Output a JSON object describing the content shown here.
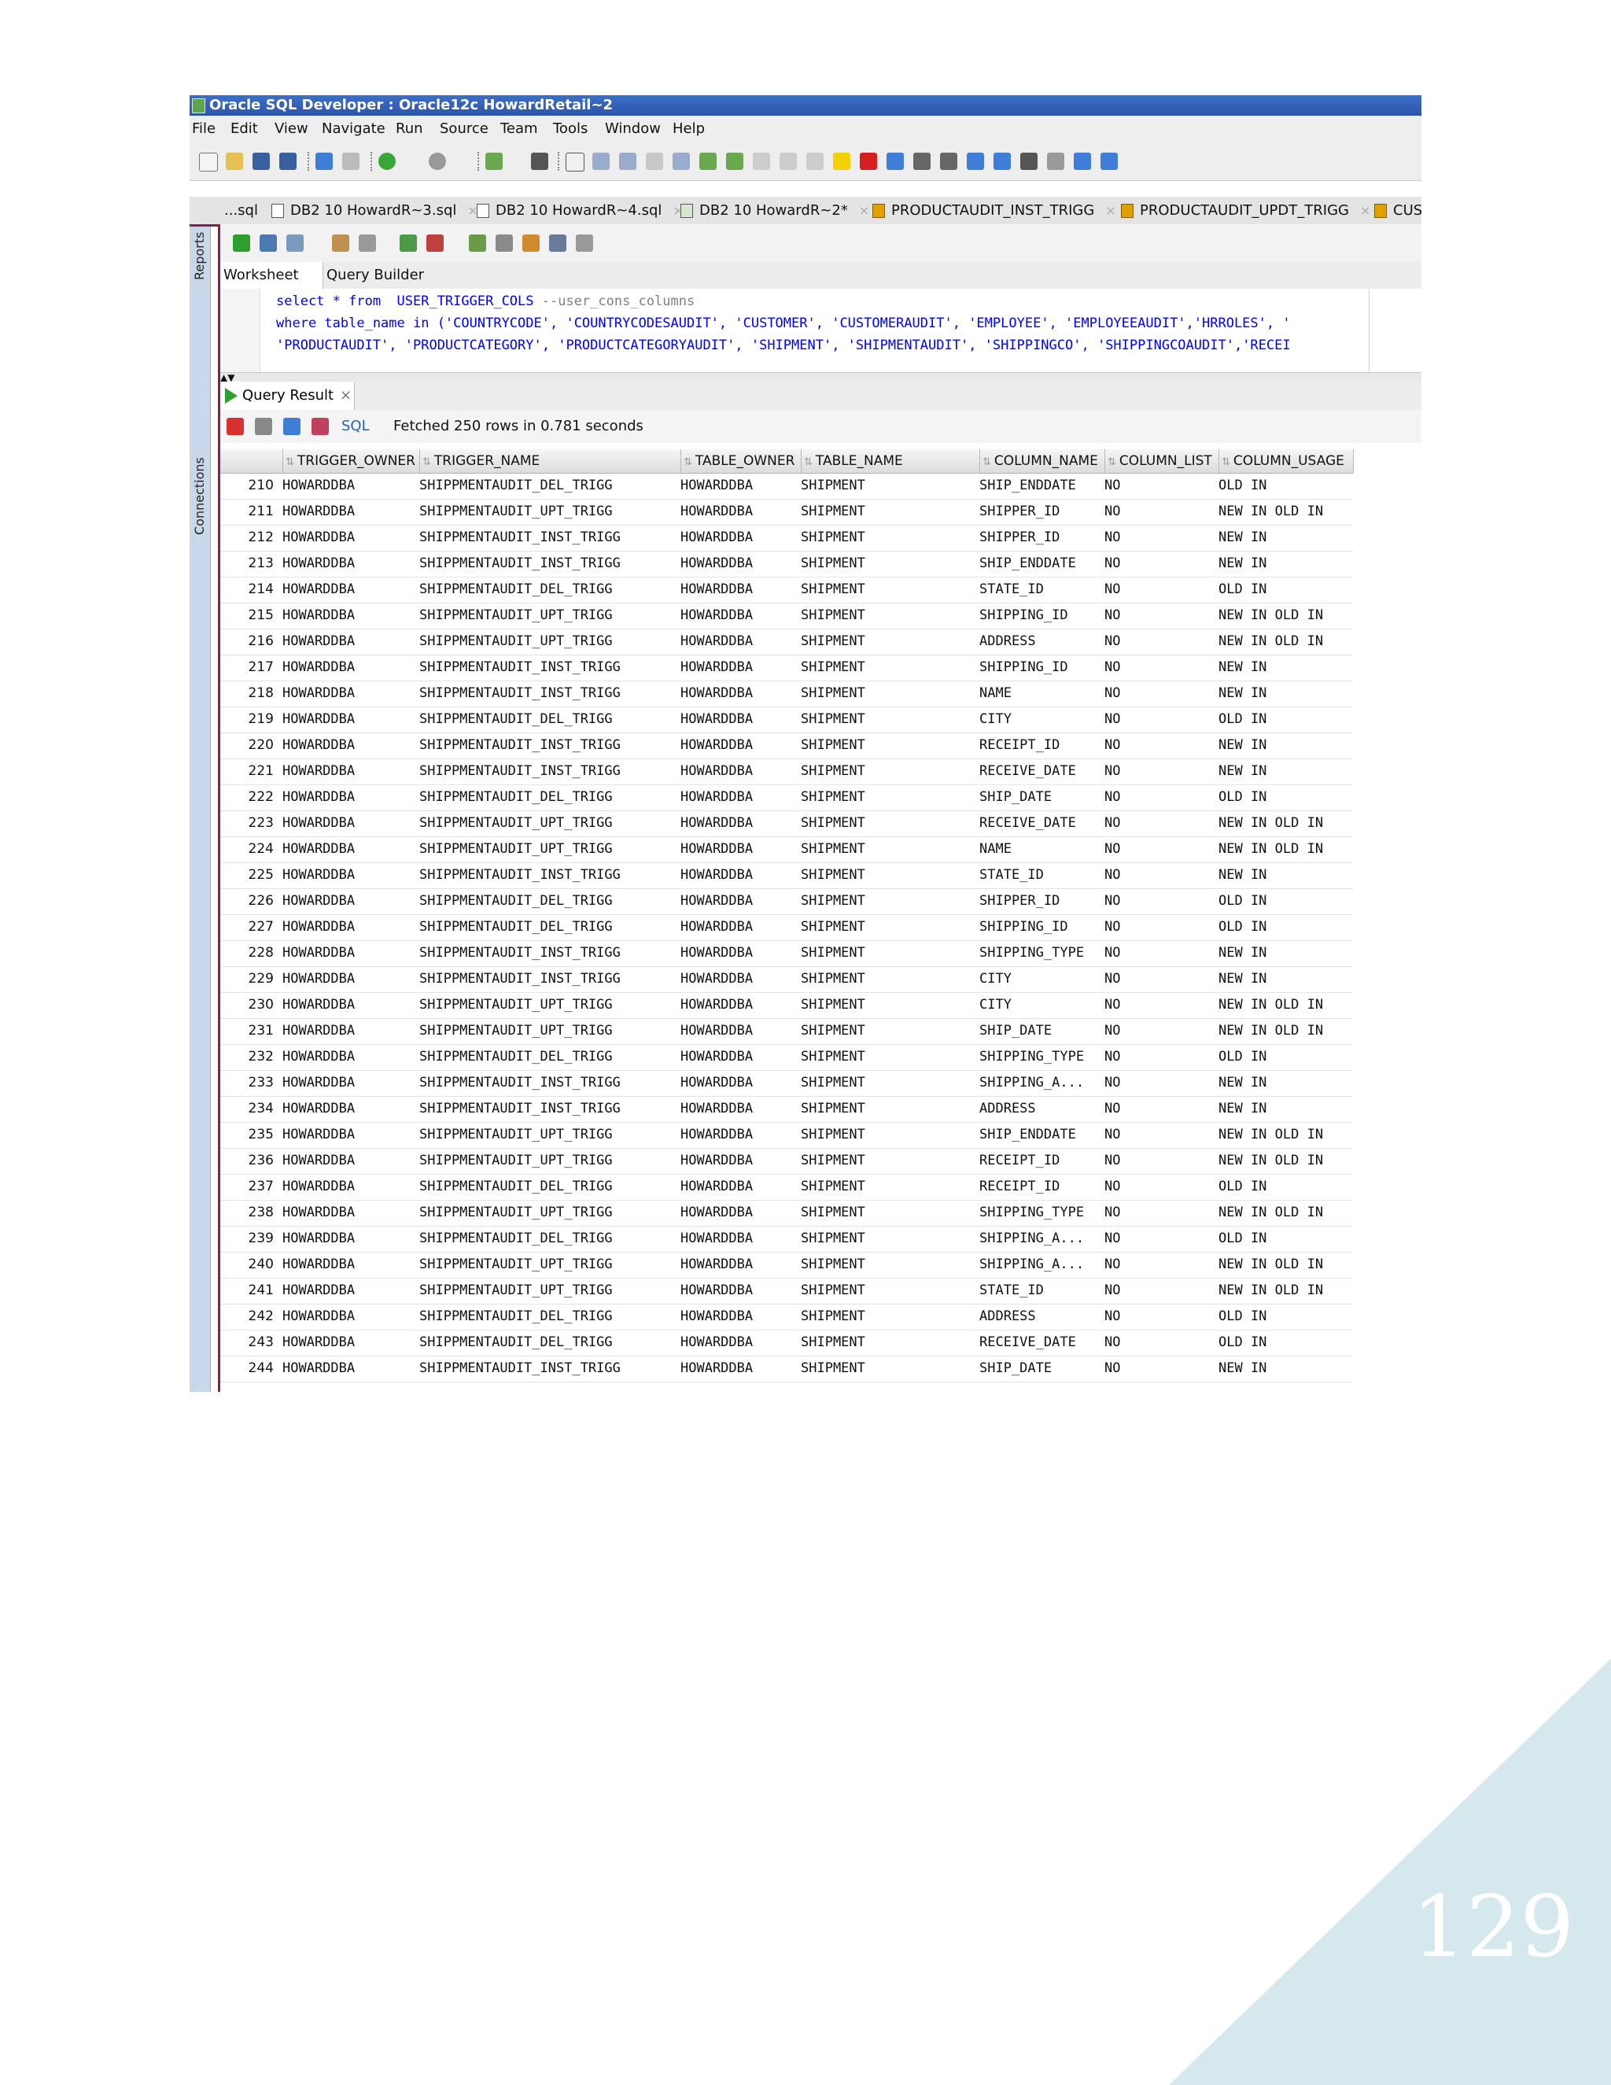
{
  "window": {
    "title": "Oracle SQL Developer : Oracle12c HowardRetail~2",
    "menu": [
      "File",
      "Edit",
      "View",
      "Navigate",
      "Run",
      "Source",
      "Team",
      "Tools",
      "Window",
      "Help"
    ]
  },
  "editor_tabs": [
    {
      "label": "...sql",
      "icon": "sql-file-icon"
    },
    {
      "label": "DB2 10 HowardR~3.sql",
      "icon": "sql-file-icon"
    },
    {
      "label": "DB2 10 HowardR~4.sql",
      "icon": "sql-file-icon"
    },
    {
      "label": "DB2 10 HowardR~2*",
      "icon": "connection-icon"
    },
    {
      "label": "PRODUCTAUDIT_INST_TRIGG",
      "icon": "trigger-icon"
    },
    {
      "label": "PRODUCTAUDIT_UPDT_TRIGG",
      "icon": "trigger-icon"
    },
    {
      "label": "CUS",
      "icon": "trigger-icon"
    }
  ],
  "side_panels": {
    "reports": "Reports",
    "connections": "Connections"
  },
  "worksheet_tabs": {
    "worksheet": "Worksheet",
    "query_builder": "Query Builder"
  },
  "sql": {
    "line1": "select * from  USER_TRIGGER_COLS --user_cons_columns",
    "line2": "where table_name in ('COUNTRYCODE', 'COUNTRYCODESAUDIT', 'CUSTOMER', 'CUSTOMERAUDIT', 'EMPLOYEE', 'EMPLOYEEAUDIT','HRROLES', '",
    "line3": "'PRODUCTAUDIT', 'PRODUCTCATEGORY', 'PRODUCTCATEGORYAUDIT', 'SHIPMENT', 'SHIPMENTAUDIT', 'SHIPPINGCO', 'SHIPPINGCOAUDIT','RECEI"
  },
  "query_result": {
    "tab_label": "Query Result",
    "sql_link": "SQL",
    "status": "Fetched 250 rows in 0.781 seconds",
    "columns": [
      "TRIGGER_OWNER",
      "TRIGGER_NAME",
      "TABLE_OWNER",
      "TABLE_NAME",
      "COLUMN_NAME",
      "COLUMN_LIST",
      "COLUMN_USAGE"
    ],
    "rows": [
      [
        "210",
        "HOWARDDBA",
        "SHIPPMENTAUDIT_DEL_TRIGG",
        "HOWARDDBA",
        "SHIPMENT",
        "SHIP_ENDDATE",
        "NO",
        "OLD IN"
      ],
      [
        "211",
        "HOWARDDBA",
        "SHIPPMENTAUDIT_UPT_TRIGG",
        "HOWARDDBA",
        "SHIPMENT",
        "SHIPPER_ID",
        "NO",
        "NEW IN OLD IN"
      ],
      [
        "212",
        "HOWARDDBA",
        "SHIPPMENTAUDIT_INST_TRIGG",
        "HOWARDDBA",
        "SHIPMENT",
        "SHIPPER_ID",
        "NO",
        "NEW IN"
      ],
      [
        "213",
        "HOWARDDBA",
        "SHIPPMENTAUDIT_INST_TRIGG",
        "HOWARDDBA",
        "SHIPMENT",
        "SHIP_ENDDATE",
        "NO",
        "NEW IN"
      ],
      [
        "214",
        "HOWARDDBA",
        "SHIPPMENTAUDIT_DEL_TRIGG",
        "HOWARDDBA",
        "SHIPMENT",
        "STATE_ID",
        "NO",
        "OLD IN"
      ],
      [
        "215",
        "HOWARDDBA",
        "SHIPPMENTAUDIT_UPT_TRIGG",
        "HOWARDDBA",
        "SHIPMENT",
        "SHIPPING_ID",
        "NO",
        "NEW IN OLD IN"
      ],
      [
        "216",
        "HOWARDDBA",
        "SHIPPMENTAUDIT_UPT_TRIGG",
        "HOWARDDBA",
        "SHIPMENT",
        "ADDRESS",
        "NO",
        "NEW IN OLD IN"
      ],
      [
        "217",
        "HOWARDDBA",
        "SHIPPMENTAUDIT_INST_TRIGG",
        "HOWARDDBA",
        "SHIPMENT",
        "SHIPPING_ID",
        "NO",
        "NEW IN"
      ],
      [
        "218",
        "HOWARDDBA",
        "SHIPPMENTAUDIT_INST_TRIGG",
        "HOWARDDBA",
        "SHIPMENT",
        "NAME",
        "NO",
        "NEW IN"
      ],
      [
        "219",
        "HOWARDDBA",
        "SHIPPMENTAUDIT_DEL_TRIGG",
        "HOWARDDBA",
        "SHIPMENT",
        "CITY",
        "NO",
        "OLD IN"
      ],
      [
        "220",
        "HOWARDDBA",
        "SHIPPMENTAUDIT_INST_TRIGG",
        "HOWARDDBA",
        "SHIPMENT",
        "RECEIPT_ID",
        "NO",
        "NEW IN"
      ],
      [
        "221",
        "HOWARDDBA",
        "SHIPPMENTAUDIT_INST_TRIGG",
        "HOWARDDBA",
        "SHIPMENT",
        "RECEIVE_DATE",
        "NO",
        "NEW IN"
      ],
      [
        "222",
        "HOWARDDBA",
        "SHIPPMENTAUDIT_DEL_TRIGG",
        "HOWARDDBA",
        "SHIPMENT",
        "SHIP_DATE",
        "NO",
        "OLD IN"
      ],
      [
        "223",
        "HOWARDDBA",
        "SHIPPMENTAUDIT_UPT_TRIGG",
        "HOWARDDBA",
        "SHIPMENT",
        "RECEIVE_DATE",
        "NO",
        "NEW IN OLD IN"
      ],
      [
        "224",
        "HOWARDDBA",
        "SHIPPMENTAUDIT_UPT_TRIGG",
        "HOWARDDBA",
        "SHIPMENT",
        "NAME",
        "NO",
        "NEW IN OLD IN"
      ],
      [
        "225",
        "HOWARDDBA",
        "SHIPPMENTAUDIT_INST_TRIGG",
        "HOWARDDBA",
        "SHIPMENT",
        "STATE_ID",
        "NO",
        "NEW IN"
      ],
      [
        "226",
        "HOWARDDBA",
        "SHIPPMENTAUDIT_DEL_TRIGG",
        "HOWARDDBA",
        "SHIPMENT",
        "SHIPPER_ID",
        "NO",
        "OLD IN"
      ],
      [
        "227",
        "HOWARDDBA",
        "SHIPPMENTAUDIT_DEL_TRIGG",
        "HOWARDDBA",
        "SHIPMENT",
        "SHIPPING_ID",
        "NO",
        "OLD IN"
      ],
      [
        "228",
        "HOWARDDBA",
        "SHIPPMENTAUDIT_INST_TRIGG",
        "HOWARDDBA",
        "SHIPMENT",
        "SHIPPING_TYPE",
        "NO",
        "NEW IN"
      ],
      [
        "229",
        "HOWARDDBA",
        "SHIPPMENTAUDIT_INST_TRIGG",
        "HOWARDDBA",
        "SHIPMENT",
        "CITY",
        "NO",
        "NEW IN"
      ],
      [
        "230",
        "HOWARDDBA",
        "SHIPPMENTAUDIT_UPT_TRIGG",
        "HOWARDDBA",
        "SHIPMENT",
        "CITY",
        "NO",
        "NEW IN OLD IN"
      ],
      [
        "231",
        "HOWARDDBA",
        "SHIPPMENTAUDIT_UPT_TRIGG",
        "HOWARDDBA",
        "SHIPMENT",
        "SHIP_DATE",
        "NO",
        "NEW IN OLD IN"
      ],
      [
        "232",
        "HOWARDDBA",
        "SHIPPMENTAUDIT_DEL_TRIGG",
        "HOWARDDBA",
        "SHIPMENT",
        "SHIPPING_TYPE",
        "NO",
        "OLD IN"
      ],
      [
        "233",
        "HOWARDDBA",
        "SHIPPMENTAUDIT_INST_TRIGG",
        "HOWARDDBA",
        "SHIPMENT",
        "SHIPPING_A...",
        "NO",
        "NEW IN"
      ],
      [
        "234",
        "HOWARDDBA",
        "SHIPPMENTAUDIT_INST_TRIGG",
        "HOWARDDBA",
        "SHIPMENT",
        "ADDRESS",
        "NO",
        "NEW IN"
      ],
      [
        "235",
        "HOWARDDBA",
        "SHIPPMENTAUDIT_UPT_TRIGG",
        "HOWARDDBA",
        "SHIPMENT",
        "SHIP_ENDDATE",
        "NO",
        "NEW IN OLD IN"
      ],
      [
        "236",
        "HOWARDDBA",
        "SHIPPMENTAUDIT_UPT_TRIGG",
        "HOWARDDBA",
        "SHIPMENT",
        "RECEIPT_ID",
        "NO",
        "NEW IN OLD IN"
      ],
      [
        "237",
        "HOWARDDBA",
        "SHIPPMENTAUDIT_DEL_TRIGG",
        "HOWARDDBA",
        "SHIPMENT",
        "RECEIPT_ID",
        "NO",
        "OLD IN"
      ],
      [
        "238",
        "HOWARDDBA",
        "SHIPPMENTAUDIT_UPT_TRIGG",
        "HOWARDDBA",
        "SHIPMENT",
        "SHIPPING_TYPE",
        "NO",
        "NEW IN OLD IN"
      ],
      [
        "239",
        "HOWARDDBA",
        "SHIPPMENTAUDIT_DEL_TRIGG",
        "HOWARDDBA",
        "SHIPMENT",
        "SHIPPING_A...",
        "NO",
        "OLD IN"
      ],
      [
        "240",
        "HOWARDDBA",
        "SHIPPMENTAUDIT_UPT_TRIGG",
        "HOWARDDBA",
        "SHIPMENT",
        "SHIPPING_A...",
        "NO",
        "NEW IN OLD IN"
      ],
      [
        "241",
        "HOWARDDBA",
        "SHIPPMENTAUDIT_UPT_TRIGG",
        "HOWARDDBA",
        "SHIPMENT",
        "STATE_ID",
        "NO",
        "NEW IN OLD IN"
      ],
      [
        "242",
        "HOWARDDBA",
        "SHIPPMENTAUDIT_DEL_TRIGG",
        "HOWARDDBA",
        "SHIPMENT",
        "ADDRESS",
        "NO",
        "OLD IN"
      ],
      [
        "243",
        "HOWARDDBA",
        "SHIPPMENTAUDIT_DEL_TRIGG",
        "HOWARDDBA",
        "SHIPMENT",
        "RECEIVE_DATE",
        "NO",
        "OLD IN"
      ],
      [
        "244",
        "HOWARDDBA",
        "SHIPPMENTAUDIT_INST_TRIGG",
        "HOWARDDBA",
        "SHIPMENT",
        "SHIP_DATE",
        "NO",
        "NEW IN"
      ]
    ]
  },
  "page_number": "129",
  "colors": {
    "corner": "#d4e8ee",
    "active_tab_border": "#8d1b4b",
    "title_bar": "#2b55a8",
    "sql_keyword": "#0000ff",
    "sql_comment": "#808080"
  }
}
